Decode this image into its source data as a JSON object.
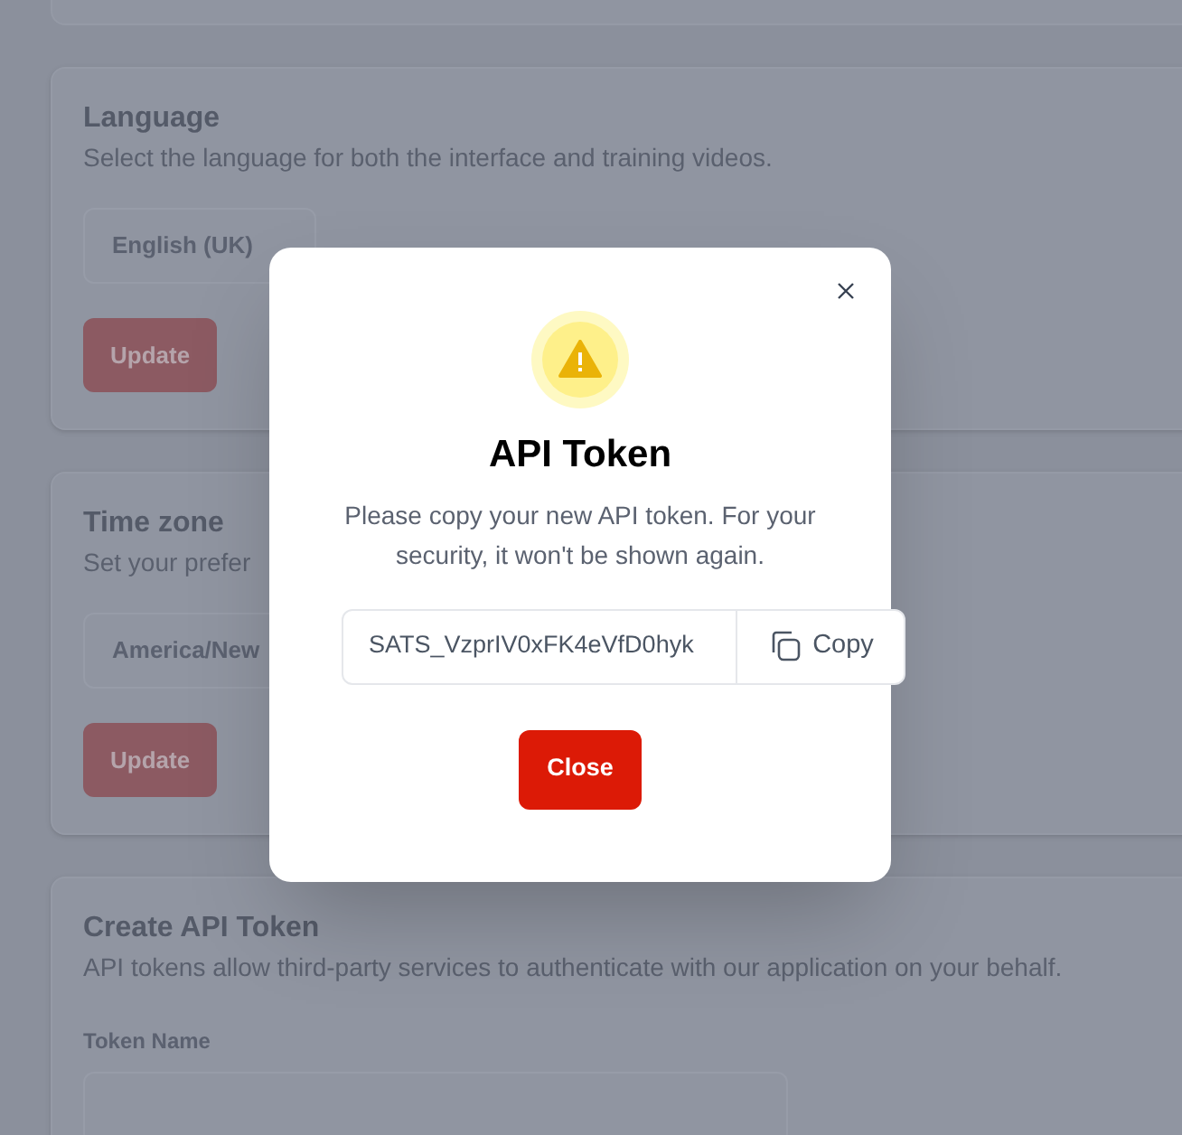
{
  "sections": [
    {
      "title": "Language",
      "description": "Select the language for both the interface and training videos.",
      "select": "English (UK)",
      "button": "Update"
    },
    {
      "title": "Time zone",
      "description": "Set your prefer",
      "select": "America/New",
      "button": "Update"
    },
    {
      "title": "Create API Token",
      "description": "API tokens allow third-party services to authenticate with our application on your behalf.",
      "field_label": "Token Name"
    }
  ],
  "dialog": {
    "title": "API Token",
    "message": "Please copy your new API token. For your security, it won't be shown again.",
    "token": "SATS_VzprIV0xFK4eVfD0hyk",
    "copy_button": "Copy",
    "close_button": "Close"
  }
}
